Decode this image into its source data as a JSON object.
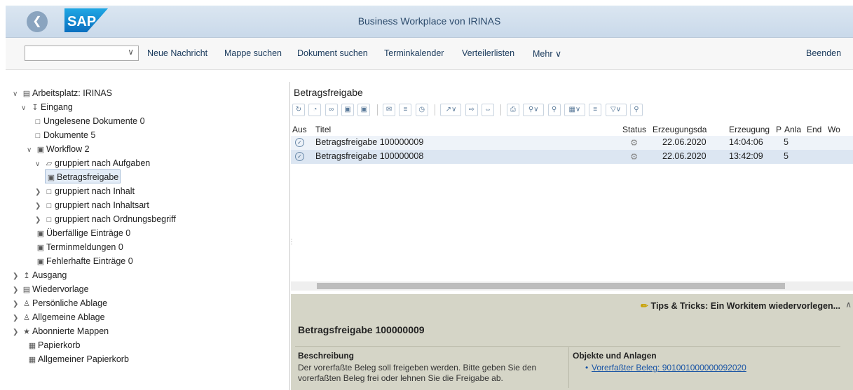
{
  "header": {
    "back_icon": "back-icon",
    "logo": "SAP",
    "title": "Business Workplace von IRINAS"
  },
  "toolbar": {
    "dropdown_value": "",
    "items": [
      "Neue Nachricht",
      "Mappe suchen",
      "Dokument suchen",
      "Terminkalender",
      "Verteilerlisten",
      "Mehr"
    ],
    "exit_label": "Beenden"
  },
  "tree": [
    {
      "label": "Arbeitsplatz: IRINAS",
      "icon": "workplace-icon"
    },
    {
      "label": "Eingang",
      "icon": "inbox-icon"
    },
    {
      "label": "Ungelesene Dokumente 0",
      "icon": "document-icon"
    },
    {
      "label": "Dokumente 5",
      "icon": "document-icon"
    },
    {
      "label": "Workflow 2",
      "icon": "workflow-icon"
    },
    {
      "label": "gruppiert nach Aufgaben",
      "icon": "open-folder-icon"
    },
    {
      "label": "Betragsfreigabe",
      "icon": "workitem-icon"
    },
    {
      "label": "gruppiert nach Inhalt",
      "icon": "folder-icon"
    },
    {
      "label": "gruppiert nach Inhaltsart",
      "icon": "folder-icon"
    },
    {
      "label": "gruppiert nach Ordnungsbegriff",
      "icon": "folder-icon"
    },
    {
      "label": "Überfällige Einträge 0",
      "icon": "workitem-icon"
    },
    {
      "label": "Terminmeldungen 0",
      "icon": "workitem-icon"
    },
    {
      "label": "Fehlerhafte Einträge 0",
      "icon": "workitem-icon"
    },
    {
      "label": "Ausgang",
      "icon": "outbox-icon"
    },
    {
      "label": "Wiedervorlage",
      "icon": "resubmission-icon"
    },
    {
      "label": "Persönliche Ablage",
      "icon": "personal-folder-icon"
    },
    {
      "label": "Allgemeine Ablage",
      "icon": "shared-folder-icon"
    },
    {
      "label": "Abonnierte Mappen",
      "icon": "subscribed-folder-icon"
    },
    {
      "label": "Papierkorb",
      "icon": "trash-icon"
    },
    {
      "label": "Allgemeiner Papierkorb",
      "icon": "trash-icon"
    }
  ],
  "list": {
    "title": "Betragsfreigabe",
    "columns": [
      "Aus",
      "Titel",
      "Status",
      "Erzeugungsda",
      "Erzeugung",
      "P",
      "Anla",
      "End",
      "Wo"
    ],
    "rows": [
      {
        "titel": "Betragsfreigabe 100000009",
        "datum": "22.06.2020",
        "zeit": "14:04:06",
        "p": "5"
      },
      {
        "titel": "Betragsfreigabe 100000008",
        "datum": "22.06.2020",
        "zeit": "13:42:09",
        "p": "5"
      }
    ]
  },
  "preview": {
    "tips": "Tips & Tricks:  Ein Workitem wiedervorlegen...",
    "doc_title": "Betragsfreigabe 100000009",
    "description_head": "Beschreibung",
    "description": "Der vorerfaßte Beleg soll freigeben werden. Bitte geben Sie den vorerfaßten Beleg frei oder lehnen Sie die Freigabe ab.",
    "objects_head": "Objekte und Anlagen",
    "object_link": "Vorerfaßter Beleg: 901001000000092020"
  },
  "colors": {
    "titlebar": "#d2e0ee",
    "selection": "#e3ecf7",
    "preview_bg": "#d5d5c7",
    "link": "#1a55a5"
  }
}
